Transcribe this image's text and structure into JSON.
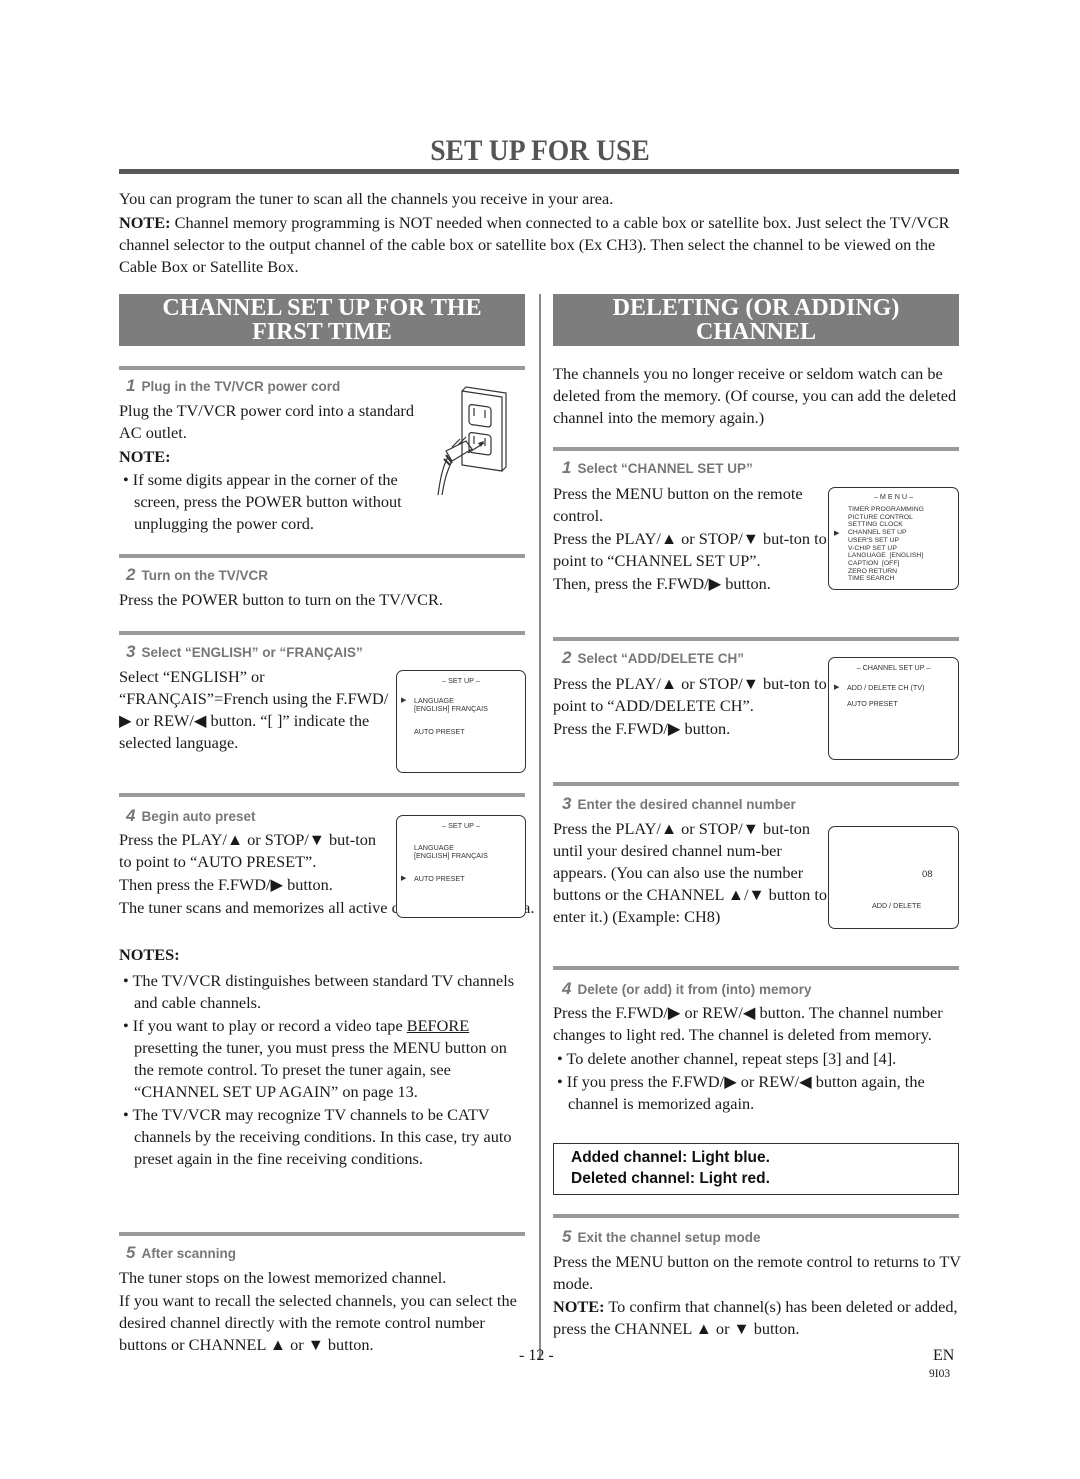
{
  "page": {
    "title": "SET UP FOR USE",
    "intro": "You can program the tuner to scan all the channels you receive in your area.",
    "note_label": "NOTE:",
    "note_text": " Channel memory programming is NOT needed when connected to a cable box or satellite box. Just select the TV/VCR channel selector to the output channel of the cable box or satellite box (Ex CH3). Then select the channel to be viewed on the Cable Box or Satellite Box.",
    "page_number": "- 12 -",
    "language_code": "EN",
    "doc_code": "9I03"
  },
  "left": {
    "header_line1": "CHANNEL SET UP FOR THE",
    "header_line2": "FIRST TIME",
    "step1": {
      "num": "1",
      "title": "Plug in the TV/VCR power cord",
      "text": "Plug the TV/VCR power cord into a standard AC outlet.",
      "note_label": "NOTE:",
      "note_bullet": "If some digits appear in the corner of the screen, press the POWER button without unplugging the power cord.",
      "illustration_icon": "power-outlet-plug-icon"
    },
    "step2": {
      "num": "2",
      "title": "Turn on the TV/VCR",
      "text": "Press the POWER button to turn on the TV/VCR."
    },
    "step3": {
      "num": "3",
      "title": "Select “ENGLISH” or “FRANÇAIS”",
      "text": "Select “ENGLISH” or “FRANÇAIS”=French using the F.FWD/▶ or REW/◀ button. “[ ]” indicate the selected language.",
      "screen": {
        "title": "– SET UP –",
        "item1": "LANGUAGE",
        "item1_value": "[ENGLISH]   FRANÇAIS",
        "item2": "AUTO PRESET",
        "cursor": "▶"
      }
    },
    "step4": {
      "num": "4",
      "title": "Begin auto preset",
      "text1": "Press the PLAY/▲ or STOP/▼ but-ton to point to “AUTO PRESET”.",
      "text2": "Then press the F.FWD/▶ button.",
      "text3": "The tuner scans and memorizes all active channels in your area.",
      "screen": {
        "title": "– SET UP –",
        "item1": "LANGUAGE",
        "item1_value": "[ENGLISH]   FRANÇAIS",
        "item2": "AUTO PRESET",
        "cursor": "▶"
      },
      "notes_label": "NOTES:",
      "note1": "The TV/VCR distinguishes between standard TV channels and cable channels.",
      "note2_pre": "If you want to play or record a video tape ",
      "note2_underlined": "BEFORE",
      "note2_post": " presetting the tuner, you must press the MENU button on the remote control. To preset the tuner again, see “CHANNEL SET UP AGAIN” on page 13.",
      "note3": "The TV/VCR may recognize TV channels to be CATV channels by the receiving conditions. In this case, try auto preset again in the fine receiving conditions."
    },
    "step5": {
      "num": "5",
      "title": "After scanning",
      "text1": "The tuner stops on the lowest memorized channel.",
      "text2": "If you want to recall the selected channels, you can select the desired channel directly with the remote control number buttons or CHANNEL ▲ or ▼ button."
    }
  },
  "right": {
    "header_line1": "DELETING (OR ADDING)",
    "header_line2": "CHANNEL",
    "intro": "The channels you no longer receive or seldom watch can be deleted from the memory. (Of course, you can add the deleted channel into the memory again.)",
    "step1": {
      "num": "1",
      "title": "Select “CHANNEL SET UP”",
      "text1": "Press the MENU button on the remote control.",
      "text2": "Press the PLAY/▲ or STOP/▼ but-ton to point to “CHANNEL SET UP”.",
      "text3": "Then, press the F.FWD/▶ button.",
      "screen": {
        "title": "– M E N U –",
        "items": [
          "TIMER PROGRAMMING",
          "PICTURE CONTROL",
          "SETTING CLOCK",
          "CHANNEL SET UP",
          "USER'S SET UP",
          "V-CHIP SET UP",
          "LANGUAGE  [ENGLISH]",
          "CAPTION  [OFF]",
          "ZERO RETURN",
          "TIME SEARCH"
        ],
        "cursor": "▶"
      }
    },
    "step2": {
      "num": "2",
      "title": "Select “ADD/DELETE CH”",
      "text1": "Press the PLAY/▲ or STOP/▼ but-ton to point to “ADD/DELETE CH”.",
      "text2": "Press the F.FWD/▶ button.",
      "screen": {
        "title": "– CHANNEL SET UP –",
        "item1": "ADD / DELETE CH (TV)",
        "item2": "AUTO PRESET",
        "cursor": "▶"
      }
    },
    "step3": {
      "num": "3",
      "title": "Enter the desired channel number",
      "text": "Press the PLAY/▲ or STOP/▼ but-ton until your desired channel num-ber appears. (You can also use the number buttons  or the CHANNEL ▲/▼ button to enter it.) (Example: CH8)",
      "screen": {
        "channel": "08",
        "label": "ADD / DELETE"
      }
    },
    "step4": {
      "num": "4",
      "title": "Delete (or add) it from (into) memory",
      "text": "Press the F.FWD/▶ or REW/◀ button. The channel number changes to light red. The channel is deleted from memory.",
      "bullet1": "To delete another channel, repeat steps [3] and [4].",
      "bullet2": "If you press the F.FWD/▶ or REW/◀ button again, the channel is memorized again.",
      "color_note1": "Added channel: Light blue.",
      "color_note2": "Deleted channel: Light red."
    },
    "step5": {
      "num": "5",
      "title": "Exit the channel setup mode",
      "text": "Press the MENU button on the remote control to returns to TV mode.",
      "note_label": "NOTE:",
      "note_text": " To confirm that channel(s) has been deleted or added, press the CHANNEL ▲ or ▼ button."
    }
  }
}
